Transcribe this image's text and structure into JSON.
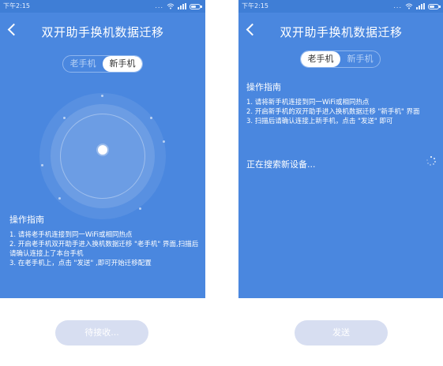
{
  "left_screen": {
    "status": {
      "time": "下午2:15",
      "more": "..."
    },
    "title": "双开助手换机数据迁移",
    "toggle": {
      "old_label": "老手机",
      "new_label": "新手机",
      "active": "new"
    },
    "guide": {
      "heading": "操作指南",
      "items": [
        "1. 请将老手机连接到同一WiFi或相同热点",
        "2. 开启老手机双开助手进入换机数据迁移 \"老手机\" 界面,扫描后请确认连接上了本台手机",
        "3. 在老手机上，点击 \"发送\" ,即可开始迁移配置"
      ]
    },
    "button_label": "待接收..."
  },
  "right_screen": {
    "status": {
      "time": "下午2:15",
      "more": "..."
    },
    "title": "双开助手换机数据迁移",
    "toggle": {
      "old_label": "老手机",
      "new_label": "新手机",
      "active": "old"
    },
    "guide": {
      "heading": "操作指南",
      "items": [
        "1. 请将新手机连接到同一WiFi或相同热点",
        "2. 开启新手机的双开助手进入换机数据迁移 \"新手机\" 界面",
        "3. 扫描后请确认连接上新手机，点击 \"发送\" 即可"
      ]
    },
    "searching_text": "正在搜索新设备...",
    "button_label": "发送"
  },
  "colors": {
    "screen_bg": "#4a87df",
    "statusbar_bg": "#3f7ed6",
    "button_bg": "#d7def1",
    "text": "#ffffff"
  },
  "icons": [
    "back-arrow-icon",
    "wifi-icon",
    "signal-icon",
    "battery-icon",
    "loading-spinner-icon"
  ]
}
